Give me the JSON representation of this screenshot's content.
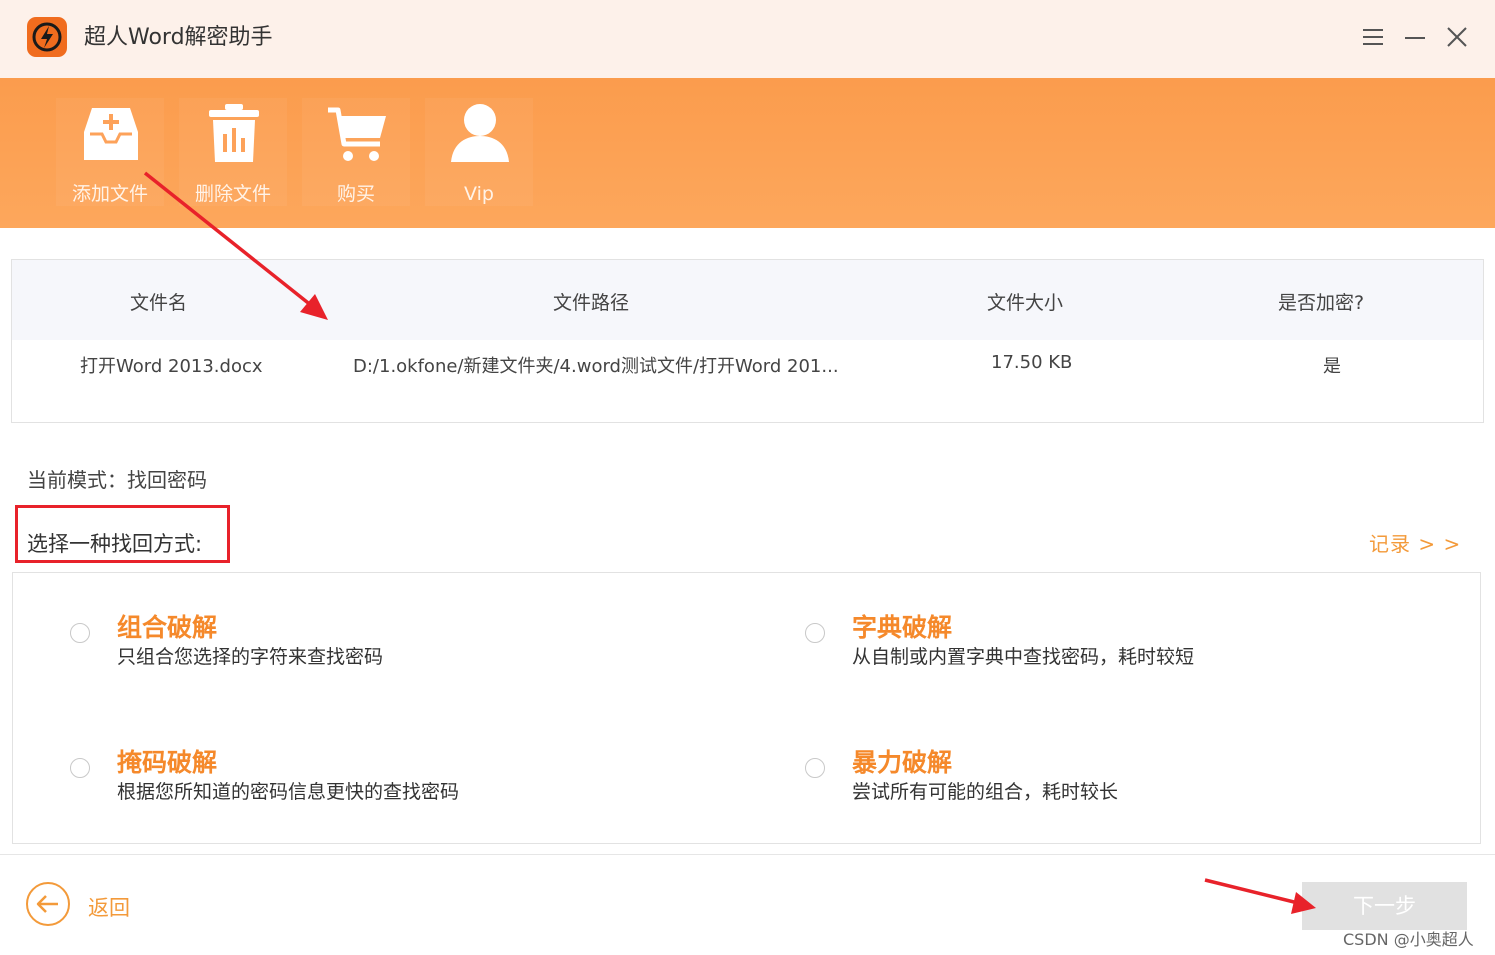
{
  "window": {
    "title": "超人Word解密助手",
    "accent_color": "#f5892b",
    "brand_color": "#f06c1e"
  },
  "toolbar": {
    "items": [
      {
        "label": "添加文件",
        "icon": "inbox-plus-icon"
      },
      {
        "label": "删除文件",
        "icon": "trash-icon"
      },
      {
        "label": "购买",
        "icon": "cart-icon"
      },
      {
        "label": "Vip",
        "icon": "user-icon"
      }
    ]
  },
  "file_table": {
    "headers": [
      "文件名",
      "文件路径",
      "文件大小",
      "是否加密?"
    ],
    "rows": [
      {
        "name": "打开Word 2013.docx",
        "path": "D:/1.okfone/新建文件夹/4.word测试文件/打开Word 201...",
        "size": "17.50 KB",
        "encrypted": "是"
      }
    ]
  },
  "mode": {
    "text": "当前模式：找回密码"
  },
  "recovery": {
    "prompt": "选择一种找回方式:",
    "records_link": "记录 > >",
    "options": [
      {
        "title": "组合破解",
        "desc": "只组合您选择的字符来查找密码",
        "selected": false
      },
      {
        "title": "字典破解",
        "desc": "从自制或内置字典中查找密码，耗时较短",
        "selected": false
      },
      {
        "title": "掩码破解",
        "desc": "根据您所知道的密码信息更快的查找密码",
        "selected": false
      },
      {
        "title": "暴力破解",
        "desc": "尝试所有可能的组合，耗时较长",
        "selected": false
      }
    ]
  },
  "footer": {
    "back_label": "返回",
    "next_label": "下一步",
    "watermark": "CSDN @小奥超人"
  },
  "annotations": {
    "arrow_color": "#e8222a"
  }
}
